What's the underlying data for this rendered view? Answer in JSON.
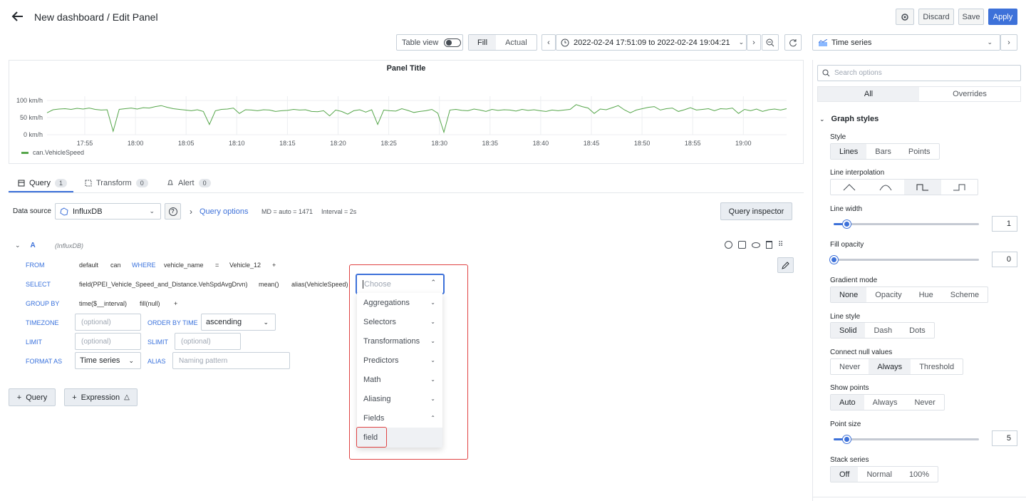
{
  "header": {
    "title": "New dashboard / Edit Panel",
    "discard_label": "Discard",
    "save_label": "Save",
    "apply_label": "Apply"
  },
  "toolbar": {
    "table_view_label": "Table view",
    "fill_label": "Fill",
    "actual_label": "Actual",
    "time_range": "2022-02-24 17:51:09 to 2022-02-24 19:04:21",
    "visualization": "Time series"
  },
  "chart_data": {
    "type": "line",
    "title": "Panel Title",
    "yticks": [
      "100 km/h",
      "50 km/h",
      "0 km/h"
    ],
    "xticks": [
      "17:55",
      "18:00",
      "18:05",
      "18:10",
      "18:15",
      "18:20",
      "18:25",
      "18:30",
      "18:35",
      "18:40",
      "18:45",
      "18:50",
      "18:55",
      "19:00"
    ],
    "ylim": [
      0,
      100
    ],
    "series": [
      {
        "name": "can.VehicleSpeed",
        "color": "#56a64b",
        "values": [
          64,
          73,
          75,
          76,
          74,
          77,
          75,
          78,
          74,
          72,
          73,
          10,
          74,
          76,
          78,
          75,
          79,
          78,
          82,
          85,
          80,
          76,
          74,
          72,
          70,
          73,
          68,
          30,
          70,
          74,
          75,
          78,
          62,
          73,
          72,
          70,
          73,
          72,
          68,
          70,
          71,
          74,
          72,
          73,
          68,
          67,
          70,
          55,
          72,
          68,
          60,
          70,
          73,
          66,
          73,
          30,
          72,
          70,
          69,
          76,
          71,
          65,
          68,
          70,
          74,
          63,
          7,
          72,
          74,
          71,
          70,
          75,
          72,
          68,
          74,
          71,
          73,
          72,
          69,
          74,
          71,
          73,
          70,
          68,
          72,
          70,
          72,
          74,
          88,
          82,
          78,
          62,
          75,
          73,
          79,
          85,
          73,
          64,
          72,
          76,
          80,
          82,
          72,
          76,
          78,
          68,
          73,
          79,
          72,
          74,
          76,
          70,
          76,
          75,
          78,
          62,
          74,
          70,
          75,
          68,
          73,
          75,
          72,
          76
        ]
      }
    ],
    "legend": "bottom-left"
  },
  "tabs": [
    {
      "label": "Query",
      "count": "1"
    },
    {
      "label": "Transform",
      "count": "0"
    },
    {
      "label": "Alert",
      "count": "0"
    }
  ],
  "datasource": {
    "label": "Data source",
    "value": "InfluxDB",
    "query_options": "Query options",
    "md": "MD = auto = 1471",
    "interval": "Interval = 2s",
    "query_inspector": "Query inspector"
  },
  "query": {
    "ref": "A",
    "source": "(InfluxDB)",
    "from_kw": "FROM",
    "from_default": "default",
    "from_measure": "can",
    "where_kw": "WHERE",
    "where_key": "vehicle_name",
    "where_op": "=",
    "where_val": "Vehicle_12",
    "plus": "+",
    "select_kw": "SELECT",
    "select_field": "field(PPEI_Vehicle_Speed_and_Distance.VehSpdAvgDrvn)",
    "select_mean": "mean()",
    "select_alias": "alias(VehicleSpeed)",
    "groupby_kw": "GROUP BY",
    "groupby_time": "time($__interval)",
    "groupby_fill": "fill(null)",
    "timezone_kw": "TIMEZONE",
    "optional": "(optional)",
    "orderby_kw": "ORDER BY TIME",
    "orderby_val": "ascending",
    "limit_kw": "LIMIT",
    "slimit_kw": "SLIMIT",
    "formatas_kw": "FORMAT AS",
    "formatas_val": "Time series",
    "alias_kw": "ALIAS",
    "alias_placeholder": "Naming pattern"
  },
  "dropdown": {
    "placeholder": "Choose",
    "items": [
      "Aggregations",
      "Selectors",
      "Transformations",
      "Predictors",
      "Math",
      "Aliasing",
      "Fields"
    ],
    "subitem": "field"
  },
  "add_query": "Query",
  "add_expression": "Expression",
  "options": {
    "search_placeholder": "Search options",
    "all_tab": "All",
    "overrides_tab": "Overrides",
    "section": "Graph styles",
    "style_label": "Style",
    "style": [
      "Lines",
      "Bars",
      "Points"
    ],
    "interp_label": "Line interpolation",
    "line_width_label": "Line width",
    "line_width": "1",
    "line_width_frac": 0.09,
    "fill_opacity_label": "Fill opacity",
    "fill_opacity": "0",
    "fill_opacity_frac": 0,
    "gradient_label": "Gradient mode",
    "gradient": [
      "None",
      "Opacity",
      "Hue",
      "Scheme"
    ],
    "line_style_label": "Line style",
    "line_style": [
      "Solid",
      "Dash",
      "Dots"
    ],
    "connect_label": "Connect null values",
    "connect": [
      "Never",
      "Always",
      "Threshold"
    ],
    "show_points_label": "Show points",
    "show_points": [
      "Auto",
      "Always",
      "Never"
    ],
    "point_size_label": "Point size",
    "point_size": "5",
    "point_size_frac": 0.09,
    "stack_label": "Stack series",
    "stack": [
      "Off",
      "Normal",
      "100%"
    ]
  }
}
